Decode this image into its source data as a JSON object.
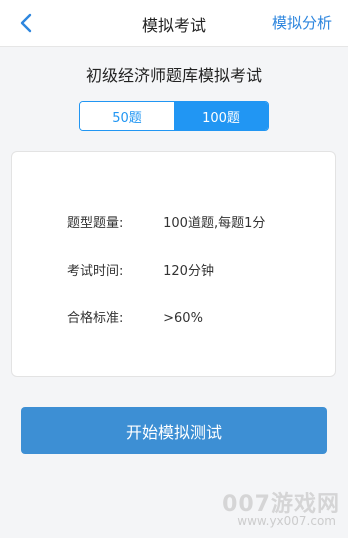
{
  "navbar": {
    "back_icon": "chevron-left-icon",
    "title": "模拟考试",
    "right_action": "模拟分析"
  },
  "exam": {
    "title": "初级经济师题库模拟考试"
  },
  "segment": {
    "options": [
      "50题",
      "100题"
    ],
    "selected_index": 1
  },
  "info": {
    "rows": [
      {
        "label": "题型题量:",
        "value": "100道题,每题1分"
      },
      {
        "label": "考试时间:",
        "value": "120分钟"
      },
      {
        "label": "合格标准:",
        "value": ">60%"
      }
    ]
  },
  "actions": {
    "start_label": "开始模拟测试"
  },
  "watermark": {
    "main": "007游戏网",
    "url": "www.yx007.com"
  },
  "colors": {
    "accent": "#2196f3",
    "button": "#3d8fd4",
    "background": "#f4f5f7"
  }
}
